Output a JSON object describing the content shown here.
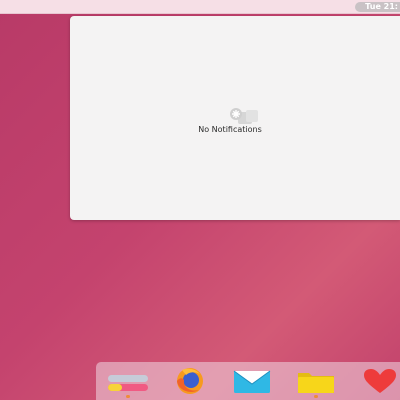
{
  "topbar": {
    "clock_text": "Tue 21:"
  },
  "notifications": {
    "empty_text": "No Notifications",
    "empty_icon": "notification-bell-icon"
  },
  "dock": {
    "items": [
      {
        "name": "settings",
        "icon": "settings-toggle-icon",
        "running": true
      },
      {
        "name": "firefox",
        "icon": "firefox-icon",
        "running": false
      },
      {
        "name": "mail",
        "icon": "mail-icon",
        "running": false
      },
      {
        "name": "files",
        "icon": "folder-icon",
        "running": true
      },
      {
        "name": "favorites",
        "icon": "heart-icon",
        "running": false
      }
    ]
  },
  "colors": {
    "desktop": "#c4436e",
    "panel": "#f4f3f3",
    "accent_orange": "#ee8c3a",
    "mail_blue": "#2fb8e5",
    "folder_yellow": "#f7d61a",
    "heart_red": "#ee3b3b"
  }
}
